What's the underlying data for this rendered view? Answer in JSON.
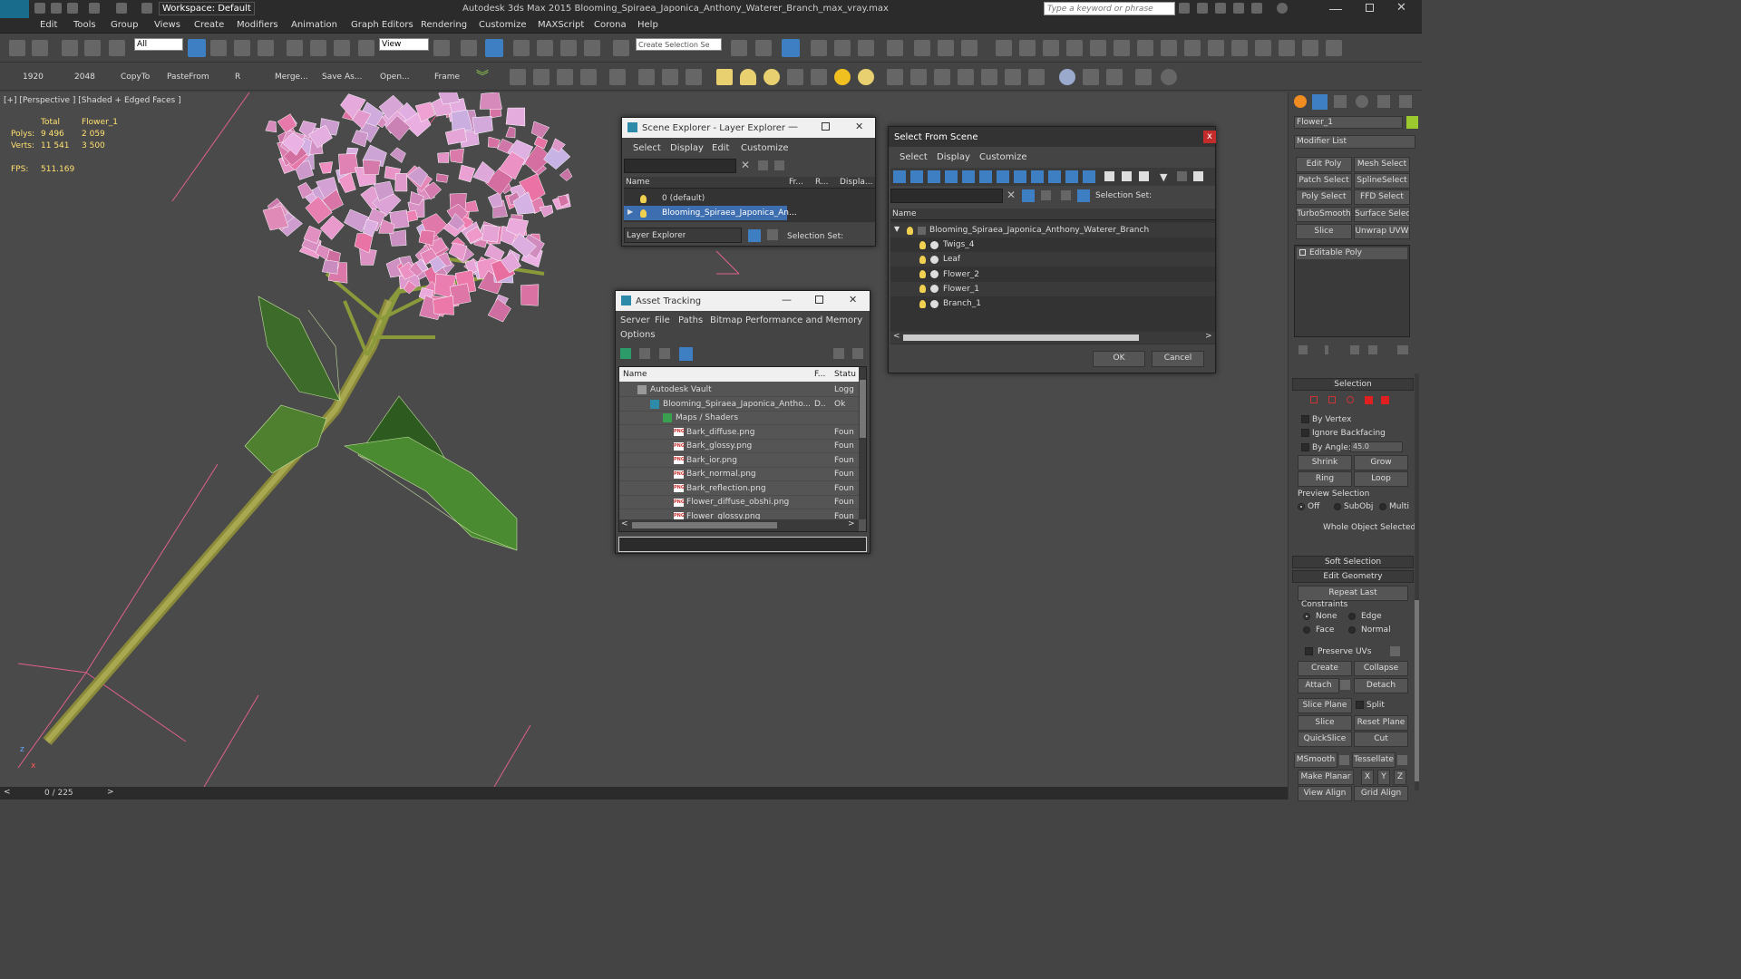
{
  "app": {
    "title": "Autodesk 3ds Max  2015     Blooming_Spiraea_Japonica_Anthony_Waterer_Branch_max_vray.max",
    "workspace": "Workspace: Default",
    "search_placeholder": "Type a keyword or phrase",
    "logo": "MAX"
  },
  "menu": [
    "Edit",
    "Tools",
    "Group",
    "Views",
    "Create",
    "Modifiers",
    "Animation",
    "Graph Editors",
    "Rendering",
    "Customize",
    "MAXScript",
    "Corona",
    "Help"
  ],
  "toolbar1": {
    "filter": "All",
    "ref_coord": "View",
    "selection_set": "Create Selection Se"
  },
  "toolbar2": {
    "labels": [
      "1920",
      "2048",
      "CopyTo",
      "PasteFrom",
      "R",
      "Merge...",
      "Save As...",
      "Open...",
      "Frame"
    ]
  },
  "viewport": {
    "label": "[+] [Perspective ] [Shaded + Edged Faces ]",
    "stats": {
      "col_total": "Total",
      "col_obj": "Flower_1",
      "polys_label": "Polys:",
      "polys_total": "9 496",
      "polys_obj": "2 059",
      "verts_label": "Verts:",
      "verts_total": "11 541",
      "verts_obj": "3 500",
      "fps_label": "FPS:",
      "fps": "511.169"
    },
    "axes": {
      "z": "z",
      "x": "x"
    }
  },
  "status": {
    "frame": "0 / 225"
  },
  "scene_explorer": {
    "title": "Scene Explorer - Layer Explorer",
    "menu": [
      "Select",
      "Display",
      "Edit",
      "Customize"
    ],
    "columns": [
      "Name",
      "Fr...",
      "R...",
      "Displa..."
    ],
    "rows": [
      "0 (default)",
      "Blooming_Spiraea_Japonica_An..."
    ],
    "footer_dropdown": "Layer Explorer",
    "footer_label": "Selection Set:"
  },
  "asset_tracking": {
    "title": "Asset Tracking",
    "menu": [
      "Server",
      "File",
      "Paths",
      "Bitmap Performance and Memory",
      "Options"
    ],
    "columns": [
      "Name",
      "F...",
      "Statu"
    ],
    "rows": [
      {
        "name": "Autodesk Vault",
        "f": "",
        "status": "Logg"
      },
      {
        "name": "Blooming_Spiraea_Japonica_Antho...",
        "f": "D..",
        "status": "Ok"
      },
      {
        "name": "Maps / Shaders",
        "f": "",
        "status": ""
      },
      {
        "name": "Bark_diffuse.png",
        "f": "",
        "status": "Foun"
      },
      {
        "name": "Bark_glossy.png",
        "f": "",
        "status": "Foun"
      },
      {
        "name": "Bark_ior.png",
        "f": "",
        "status": "Foun"
      },
      {
        "name": "Bark_normal.png",
        "f": "",
        "status": "Foun"
      },
      {
        "name": "Bark_reflection.png",
        "f": "",
        "status": "Foun"
      },
      {
        "name": "Flower_diffuse_obshi.png",
        "f": "",
        "status": "Foun"
      },
      {
        "name": "Flower_glossy.png",
        "f": "",
        "status": "Foun"
      }
    ],
    "png_badge": "PNG"
  },
  "select_from_scene": {
    "title": "Select From Scene",
    "menu": [
      "Select",
      "Display",
      "Customize"
    ],
    "selection_set_label": "Selection Set:",
    "column": "Name",
    "root": "Blooming_Spiraea_Japonica_Anthony_Waterer_Branch",
    "children": [
      "Twigs_4",
      "Leaf",
      "Flower_2",
      "Flower_1",
      "Branch_1"
    ],
    "ok": "OK",
    "cancel": "Cancel",
    "close": "x"
  },
  "command_panel": {
    "object_name": "Flower_1",
    "object_color": "#9bc92e",
    "modifier_list": "Modifier List",
    "modifier_buttons": [
      "Edit Poly",
      "Mesh Select",
      "Patch Select",
      "SplineSelect",
      "Poly Select",
      "FFD Select",
      "TurboSmooth",
      "Surface Select",
      "Slice",
      "Unwrap UVW"
    ],
    "stack_item": "Editable Poly",
    "selection_header": "Selection",
    "by_vertex": "By Vertex",
    "ignore_backfacing": "Ignore Backfacing",
    "by_angle": "By Angle:",
    "angle_value": "45.0",
    "shrink": "Shrink",
    "grow": "Grow",
    "ring": "Ring",
    "loop": "Loop",
    "preview_selection": "Preview Selection",
    "preview_opts": [
      "Off",
      "SubObj",
      "Multi"
    ],
    "whole_object": "Whole Object Selected",
    "soft_selection": "Soft Selection",
    "edit_geometry": "Edit Geometry",
    "repeat_last": "Repeat Last",
    "constraints": "Constraints",
    "constraint_opts": [
      "None",
      "Edge",
      "Face",
      "Normal"
    ],
    "preserve_uvs": "Preserve UVs",
    "create": "Create",
    "collapse": "Collapse",
    "attach": "Attach",
    "detach": "Detach",
    "slice_plane": "Slice Plane",
    "split": "Split",
    "slice": "Slice",
    "reset_plane": "Reset Plane",
    "quickslice": "QuickSlice",
    "cut": "Cut",
    "msmooth": "MSmooth",
    "tessellate": "Tessellate",
    "make_planar": "Make Planar",
    "x": "X",
    "y": "Y",
    "z": "Z",
    "view_align": "View Align",
    "grid_align": "Grid Align"
  }
}
